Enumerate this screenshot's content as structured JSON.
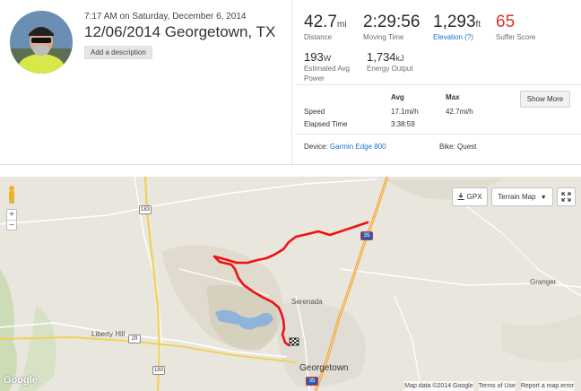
{
  "activity": {
    "datetime": "7:17 AM on Saturday, December 6, 2014",
    "title": "12/06/2014 Georgetown, TX",
    "add_description": "Add a description"
  },
  "stats": {
    "distance": {
      "value": "42.7",
      "unit": "mi",
      "label": "Distance"
    },
    "moving_time": {
      "value": "2:29:56",
      "label": "Moving Time"
    },
    "elevation": {
      "value": "1,293",
      "unit": "ft",
      "label": "Elevation (?)"
    },
    "suffer_score": {
      "value": "65",
      "label": "Suffer Score"
    },
    "power": {
      "value": "193",
      "unit": "W",
      "label_line1": "Estimated Avg",
      "label_line2": "Power"
    },
    "energy": {
      "value": "1,734",
      "unit": "kJ",
      "label": "Energy Output"
    }
  },
  "table": {
    "col_avg": "Avg",
    "col_max": "Max",
    "speed_label": "Speed",
    "speed_avg": "17.1mi/h",
    "speed_max": "42.7mi/h",
    "elapsed_label": "Elapsed Time",
    "elapsed_value": "3:38:59",
    "show_more": "Show More"
  },
  "equipment": {
    "device_label": "Device:",
    "device_value": "Garmin Edge 800",
    "bike_label": "Bike:",
    "bike_value": "Quest"
  },
  "map": {
    "gpx_label": "GPX",
    "terrain_label": "Terrain Map",
    "zoom_in": "+",
    "zoom_out": "−",
    "places": {
      "serenada": "Serenada",
      "georgetown": "Georgetown",
      "liberty_hill": "Liberty Hill",
      "granger": "Granger"
    },
    "shields": {
      "r183a": "183",
      "r183b": "183",
      "r29": "29",
      "i35a": "35",
      "i35b": "35"
    },
    "google": "Google",
    "attribution": {
      "data": "Map data ©2014 Google",
      "terms": "Terms of Use",
      "report": "Report a map error"
    },
    "route_color": "#ee1111",
    "icons": [
      "pegman-icon",
      "download-icon",
      "caret-down-icon",
      "fullscreen-icon",
      "finish-flag-icon"
    ]
  }
}
